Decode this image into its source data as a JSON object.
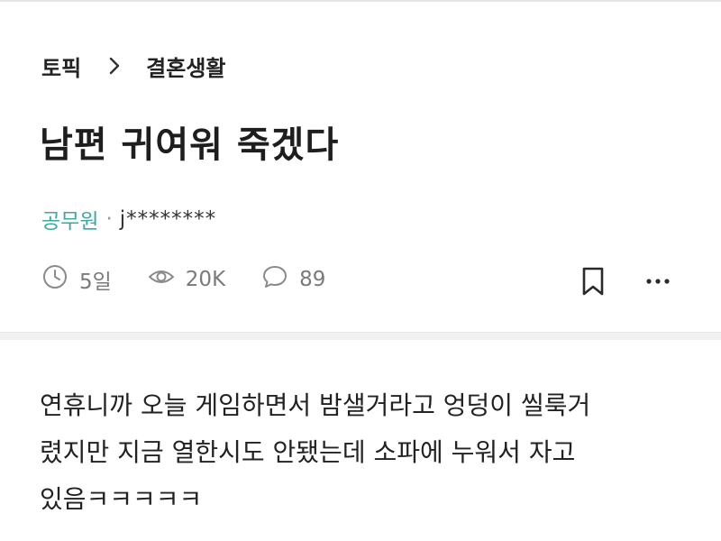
{
  "breadcrumb": {
    "topic": "토픽",
    "separator_icon": "chevron-right-icon",
    "category": "결혼생활"
  },
  "post": {
    "title": "남편 귀여워 죽겠다",
    "author": {
      "company": "공무원",
      "separator": "·",
      "nickname": "j********"
    },
    "stats": {
      "time": "5일",
      "views": "20K",
      "comments": "89"
    },
    "content_lines": [
      "연휴니까 오늘 게임하면서 밤샐거라고 엉덩이 씰룩거",
      "렸지만 지금 열한시도 안됐는데 소파에 누워서 자고",
      "있음ㅋㅋㅋㅋㅋ"
    ]
  },
  "colors": {
    "company_accent": "#3aa9a0",
    "meta_gray": "#7a7a7a",
    "text": "#222222"
  },
  "icons": {
    "time": "clock-icon",
    "views": "eye-icon",
    "comments": "comment-icon",
    "bookmark": "bookmark-icon",
    "more": "more-icon"
  }
}
